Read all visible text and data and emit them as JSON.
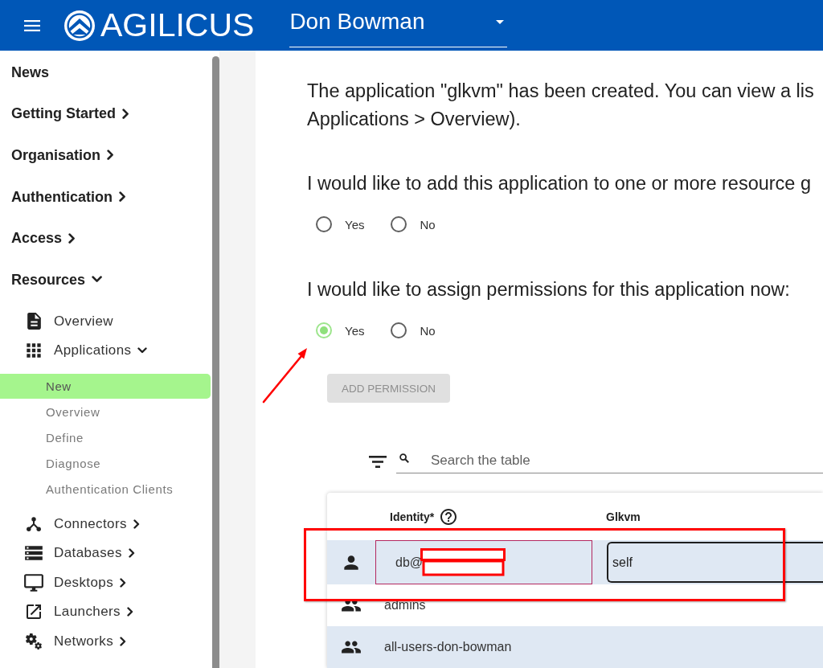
{
  "header": {
    "logo": {
      "text": "AGILICUS"
    },
    "org_select": {
      "value": "Don Bowman"
    }
  },
  "sidebar": {
    "items": [
      {
        "label": "News",
        "kind": "link"
      },
      {
        "label": "Getting Started",
        "kind": "group",
        "expanded": false
      },
      {
        "label": "Organisation",
        "kind": "group",
        "expanded": false
      },
      {
        "label": "Authentication",
        "kind": "group",
        "expanded": false
      },
      {
        "label": "Access",
        "kind": "group",
        "expanded": false
      },
      {
        "label": "Resources",
        "kind": "group",
        "expanded": true,
        "children": [
          {
            "label": "Overview",
            "kind": "link"
          },
          {
            "label": "Applications",
            "kind": "group",
            "expanded": true,
            "children": [
              {
                "label": "New",
                "selected": true
              },
              {
                "label": "Overview",
                "selected": false
              },
              {
                "label": "Define",
                "selected": false
              },
              {
                "label": "Diagnose",
                "selected": false
              },
              {
                "label": "Authentication Clients",
                "selected": false
              }
            ]
          },
          {
            "label": "Connectors",
            "kind": "group",
            "expanded": false
          },
          {
            "label": "Databases",
            "kind": "group",
            "expanded": false
          },
          {
            "label": "Desktops",
            "kind": "group",
            "expanded": false
          },
          {
            "label": "Launchers",
            "kind": "group",
            "expanded": false
          },
          {
            "label": "Networks",
            "kind": "group",
            "expanded": false
          }
        ]
      }
    ]
  },
  "content": {
    "message_lines": [
      "The application \"glkvm\" has been created. You can view a lis",
      "Applications > Overview)."
    ],
    "questions": [
      {
        "text": "I would like to add this application to one or more resource g",
        "options": [
          {
            "label": "Yes",
            "selected": false
          },
          {
            "label": "No",
            "selected": false
          }
        ]
      },
      {
        "text": "I would like to assign permissions for this application now:",
        "options": [
          {
            "label": "Yes",
            "selected": true
          },
          {
            "label": "No",
            "selected": false
          }
        ]
      }
    ],
    "add_button": {
      "label": "ADD PERMISSION",
      "disabled": true
    },
    "search": {
      "placeholder": "Search the table"
    },
    "table": {
      "columns": [
        {
          "label": "Identity*",
          "help": true
        },
        {
          "label": "Glkvm",
          "help": false
        }
      ],
      "rows": [
        {
          "kind": "user",
          "identity": "db@",
          "editing": true,
          "permission": "self"
        },
        {
          "kind": "group",
          "identity": "admins",
          "editing": false
        },
        {
          "kind": "group",
          "identity": "all-users-don-bowman",
          "editing": false
        }
      ]
    }
  }
}
